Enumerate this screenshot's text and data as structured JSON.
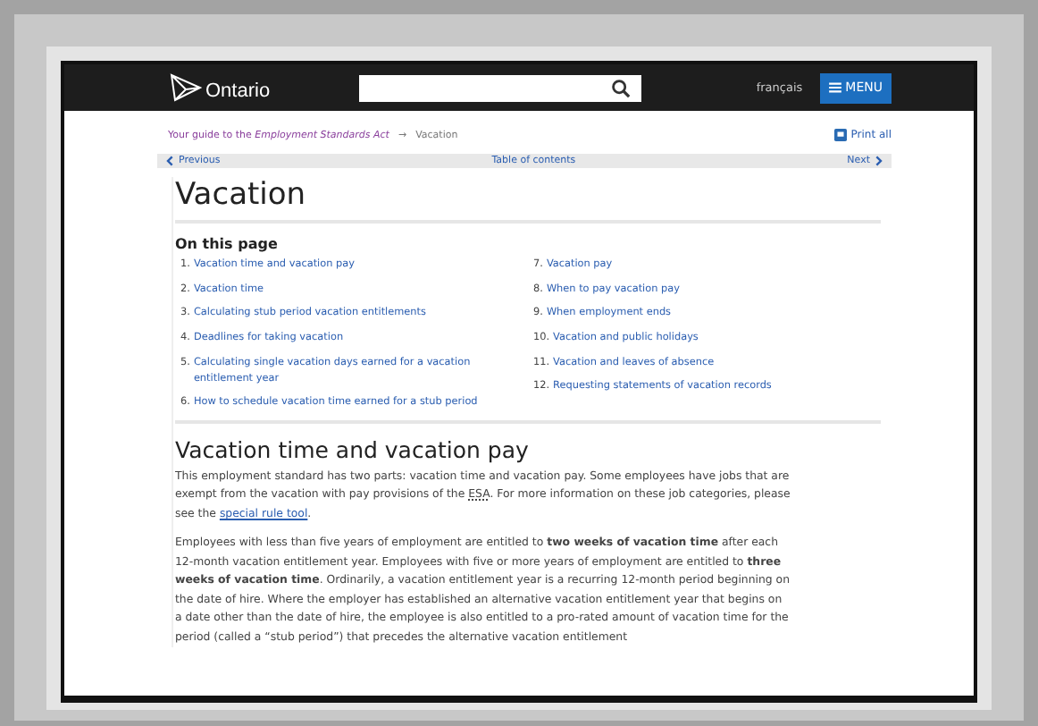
{
  "header": {
    "logo_text": "Ontario",
    "language_link": "français",
    "menu_button": "MENU"
  },
  "breadcrumb": {
    "link": "Your guide to the *Employment Standards Act*",
    "separator": "→",
    "current": "Vacation",
    "print_link": "Print all"
  },
  "pager": {
    "previous": "Previous",
    "contents": "Table of contents",
    "next": "Next"
  },
  "title": "Vacation",
  "on_this_page": {
    "heading": "On this page",
    "items": [
      {
        "number": "1.",
        "text": "Vacation time and vacation pay"
      },
      {
        "number": "2.",
        "text": "Vacation time"
      },
      {
        "number": "3.",
        "text": "Calculating stub period vacation entitlements"
      },
      {
        "number": "4.",
        "text": "Deadlines for taking vacation"
      },
      {
        "number": "5.",
        "text": "Calculating single vacation days earned for a vacation entitlement year"
      },
      {
        "number": "6.",
        "text": "How to schedule vacation time earned for a stub period"
      },
      {
        "number": "7.",
        "text": "Vacation pay"
      },
      {
        "number": "8.",
        "text": "When to pay vacation pay"
      },
      {
        "number": "9.",
        "text": "When employment ends"
      },
      {
        "number": "10.",
        "text": "Vacation and public holidays"
      },
      {
        "number": "11.",
        "text": "Vacation and leaves of absence"
      },
      {
        "number": "12.",
        "text": "Requesting statements of vacation records"
      }
    ]
  },
  "section": {
    "heading": "Vacation time and vacation pay",
    "paragraphs": [
      {
        "parts": [
          {
            "kind": "text",
            "text": "This employment standard has two parts: vacation time and vacation pay. Some employees have jobs that are exempt from the vacation with pay provisions of the "
          },
          {
            "kind": "abbr",
            "text": "ESA"
          },
          {
            "kind": "text",
            "text": ". For more information on these job categories, please see the "
          },
          {
            "kind": "link",
            "text": "special rule tool"
          },
          {
            "kind": "text",
            "text": "."
          }
        ]
      },
      {
        "parts": [
          {
            "kind": "text",
            "text": "Employees with less than five years of employment are entitled to **two weeks of vacation time** after each 12-month vacation entitlement year. Employees with five or more years of employment are entitled to **three weeks of vacation time**. Ordinarily, a vacation entitlement year is a recurring 12-month period beginning on the date of hire. Where the employer has established an alternative vacation entitlement year that begins on a date other than the date of hire, the employee is also entitled to a pro-rated amount of vacation time for the period (called a “stub period”) that precedes the alternative vacation entitlement"
          }
        ]
      }
    ]
  }
}
